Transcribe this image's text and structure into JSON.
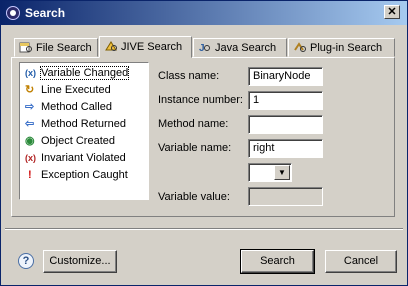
{
  "window": {
    "title": "Search",
    "close_label": "✕"
  },
  "tabs": [
    {
      "label": "File Search",
      "icon": "file-search-icon"
    },
    {
      "label": "JIVE Search",
      "icon": "jive-search-icon"
    },
    {
      "label": "Java Search",
      "icon": "java-search-icon"
    },
    {
      "label": "Plug-in Search",
      "icon": "plugin-search-icon"
    }
  ],
  "search_types": [
    {
      "label": "Variable Changed",
      "icon": "variable-changed-icon",
      "glyph": "(x)"
    },
    {
      "label": "Line Executed",
      "icon": "line-executed-icon",
      "glyph": "↻"
    },
    {
      "label": "Method Called",
      "icon": "method-called-icon",
      "glyph": "⇨"
    },
    {
      "label": "Method Returned",
      "icon": "method-returned-icon",
      "glyph": "⇦"
    },
    {
      "label": "Object Created",
      "icon": "object-created-icon",
      "glyph": "◉"
    },
    {
      "label": "Invariant Violated",
      "icon": "invariant-violated-icon",
      "glyph": "(x)"
    },
    {
      "label": "Exception Caught",
      "icon": "exception-caught-icon",
      "glyph": "!"
    }
  ],
  "form": {
    "class_name": {
      "label": "Class name:",
      "value": "BinaryNode"
    },
    "instance_number": {
      "label": "Instance number:",
      "value": "1"
    },
    "method_name": {
      "label": "Method name:",
      "value": ""
    },
    "variable_name": {
      "label": "Variable name:",
      "value": "right"
    },
    "operator": {
      "value": ""
    },
    "variable_value": {
      "label": "Variable value:",
      "value": ""
    }
  },
  "buttons": {
    "help": "?",
    "customize": "Customize...",
    "search": "Search",
    "cancel": "Cancel"
  }
}
